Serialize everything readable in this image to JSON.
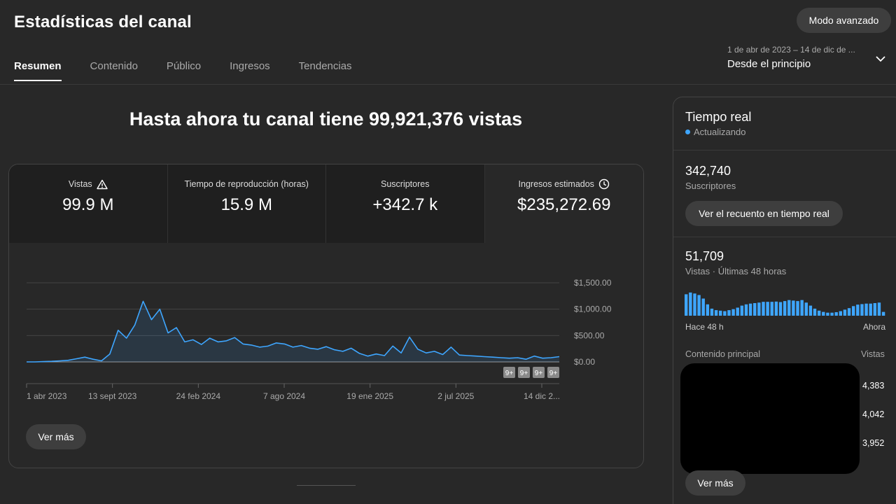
{
  "header": {
    "title": "Estadísticas del canal",
    "advanced_mode_label": "Modo avanzado"
  },
  "tabs": [
    {
      "label": "Resumen",
      "active": true
    },
    {
      "label": "Contenido",
      "active": false
    },
    {
      "label": "Público",
      "active": false
    },
    {
      "label": "Ingresos",
      "active": false
    },
    {
      "label": "Tendencias",
      "active": false
    }
  ],
  "date_range": {
    "dates": "1 de abr de 2023 – 14 de dic de ...",
    "label": "Desde el principio"
  },
  "headline": "Hasta ahora tu canal tiene 99,921,376 vistas",
  "metrics": [
    {
      "label": "Vistas",
      "value": "99.9 M",
      "icon": "warning-icon"
    },
    {
      "label": "Tiempo de reproducción (horas)",
      "value": "15.9 M"
    },
    {
      "label": "Suscriptores",
      "value": "+342.7 k"
    },
    {
      "label": "Ingresos estimados",
      "value": "$235,272.69",
      "icon": "clock-icon"
    }
  ],
  "chart_data": {
    "type": "area",
    "y_tick_labels": [
      "$1,500.00",
      "$1,000.00",
      "$500.00",
      "$0.00"
    ],
    "ylim": [
      0,
      1500
    ],
    "x_tick_labels": [
      "1 abr 2023",
      "13 sept 2023",
      "24 feb 2024",
      "7 ago 2024",
      "19 ene 2025",
      "2 jul 2025",
      "14 dic 2..."
    ],
    "series": [
      {
        "values": [
          0,
          0,
          5,
          10,
          20,
          30,
          60,
          90,
          50,
          20,
          150,
          600,
          450,
          700,
          1150,
          800,
          1000,
          550,
          650,
          380,
          420,
          330,
          450,
          380,
          400,
          460,
          340,
          320,
          280,
          300,
          360,
          340,
          280,
          310,
          260,
          240,
          290,
          230,
          200,
          260,
          160,
          110,
          150,
          120,
          300,
          170,
          470,
          240,
          170,
          200,
          140,
          280,
          130,
          120,
          110,
          100,
          90,
          80,
          70,
          80,
          50,
          110,
          70,
          80,
          100
        ]
      }
    ],
    "markers": [
      "9+",
      "9+",
      "9+",
      "9+"
    ],
    "grid": true,
    "color": "#3ea6ff"
  },
  "more_label": "Ver más",
  "realtime": {
    "title": "Tiempo real",
    "status": "Actualizando",
    "subscribers_value": "342,740",
    "subscribers_label": "Suscriptores",
    "realtime_button": "Ver el recuento en tiempo real",
    "views_value": "51,709",
    "views_label": "Vistas · Últimas 48 horas",
    "bars": [
      85,
      92,
      88,
      82,
      68,
      45,
      28,
      22,
      20,
      18,
      22,
      26,
      32,
      40,
      45,
      48,
      50,
      52,
      55,
      55,
      55,
      56,
      54,
      58,
      62,
      60,
      58,
      62,
      52,
      40,
      28,
      20,
      15,
      12,
      12,
      14,
      18,
      24,
      30,
      38,
      44,
      46,
      48,
      48,
      50,
      52,
      15
    ],
    "axis_start": "Hace 48 h",
    "axis_end": "Ahora",
    "top_content_label": "Contenido principal",
    "views_col_label": "Vistas",
    "top_values": [
      "4,383",
      "4,042",
      "3,952"
    ],
    "more_label": "Ver más"
  }
}
